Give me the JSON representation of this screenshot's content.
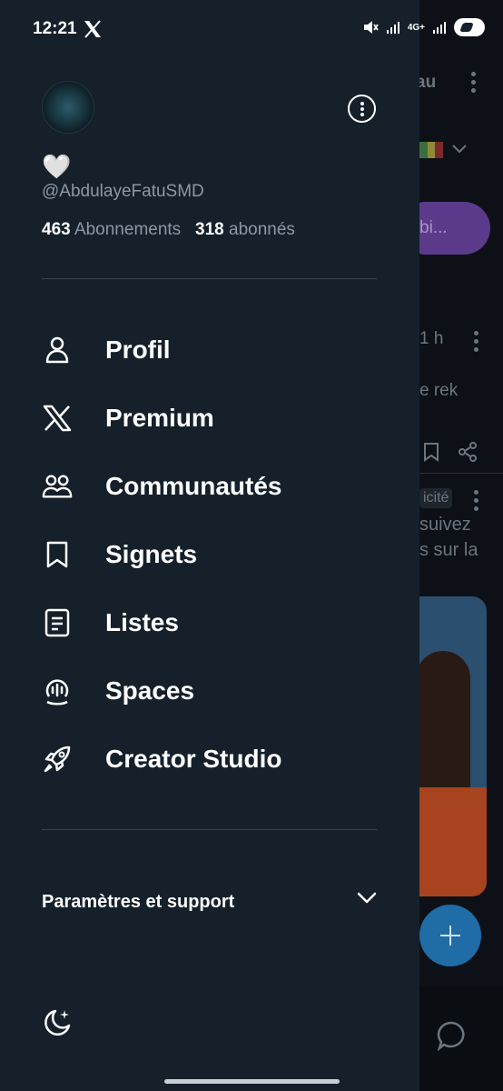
{
  "status_bar": {
    "time": "12:21",
    "network": "4G+"
  },
  "background": {
    "header_fragment": "au",
    "pill_fragment": "bi...",
    "tweet_time": "1 h",
    "tweet_text": "e rek",
    "ad_label": "icité",
    "ad_text_1": "suivez",
    "ad_text_2": "s sur la",
    "accent_color": "#1d9bf0"
  },
  "profile": {
    "name_emoji": "🤍",
    "handle": "@AbdulayeFatuSMD",
    "following_count": "463",
    "following_label": "Abonnements",
    "followers_count": "318",
    "followers_label": "abonnés"
  },
  "menu": {
    "items": [
      {
        "label": "Profil",
        "icon": "person-icon"
      },
      {
        "label": "Premium",
        "icon": "x-logo-icon"
      },
      {
        "label": "Communautés",
        "icon": "communities-icon"
      },
      {
        "label": "Signets",
        "icon": "bookmark-icon"
      },
      {
        "label": "Listes",
        "icon": "list-icon"
      },
      {
        "label": "Spaces",
        "icon": "spaces-icon"
      },
      {
        "label": "Creator Studio",
        "icon": "rocket-icon"
      }
    ]
  },
  "settings": {
    "label": "Paramètres et support"
  },
  "colors": {
    "drawer_bg": "#15202b",
    "divider": "#38444d",
    "secondary_text": "#8b98a5"
  }
}
